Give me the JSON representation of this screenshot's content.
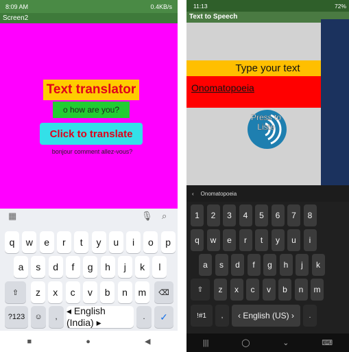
{
  "left_phone": {
    "status": {
      "time": "8:09 AM",
      "network": "0.4KB/s"
    },
    "app_title": "Screen2",
    "title_label": "Text translator",
    "input_text": "o how are you?",
    "button_label": "Click to translate",
    "output_text": "bonjour comment allez-vous?",
    "keyboard": {
      "row1": [
        "q",
        "w",
        "e",
        "r",
        "t",
        "y",
        "u",
        "i",
        "o",
        "p"
      ],
      "row2": [
        "a",
        "s",
        "d",
        "f",
        "g",
        "h",
        "j",
        "k",
        "l"
      ],
      "row3": [
        "z",
        "x",
        "c",
        "v",
        "b",
        "n",
        "m"
      ],
      "sym_label": "?123",
      "space_label": "English (India)"
    }
  },
  "right_phone": {
    "status": {
      "time": "11:13",
      "battery": "72%"
    },
    "app_title": "Text to Speech",
    "type_label": "Type your text",
    "input_text": "Onomatopoeia",
    "button_label": "Press to Liste",
    "suggestion": "Onomatopoeia",
    "keyboard": {
      "numbers": [
        "1",
        "2",
        "3",
        "4",
        "5",
        "6",
        "7",
        "8"
      ],
      "row1": [
        "q",
        "w",
        "e",
        "r",
        "t",
        "y",
        "u",
        "i"
      ],
      "row2": [
        "a",
        "s",
        "d",
        "f",
        "g",
        "h",
        "j",
        "k"
      ],
      "row3": [
        "z",
        "x",
        "c",
        "v",
        "b",
        "n",
        "m"
      ],
      "sym_label": "!#1",
      "space_label": "English (US)"
    }
  }
}
